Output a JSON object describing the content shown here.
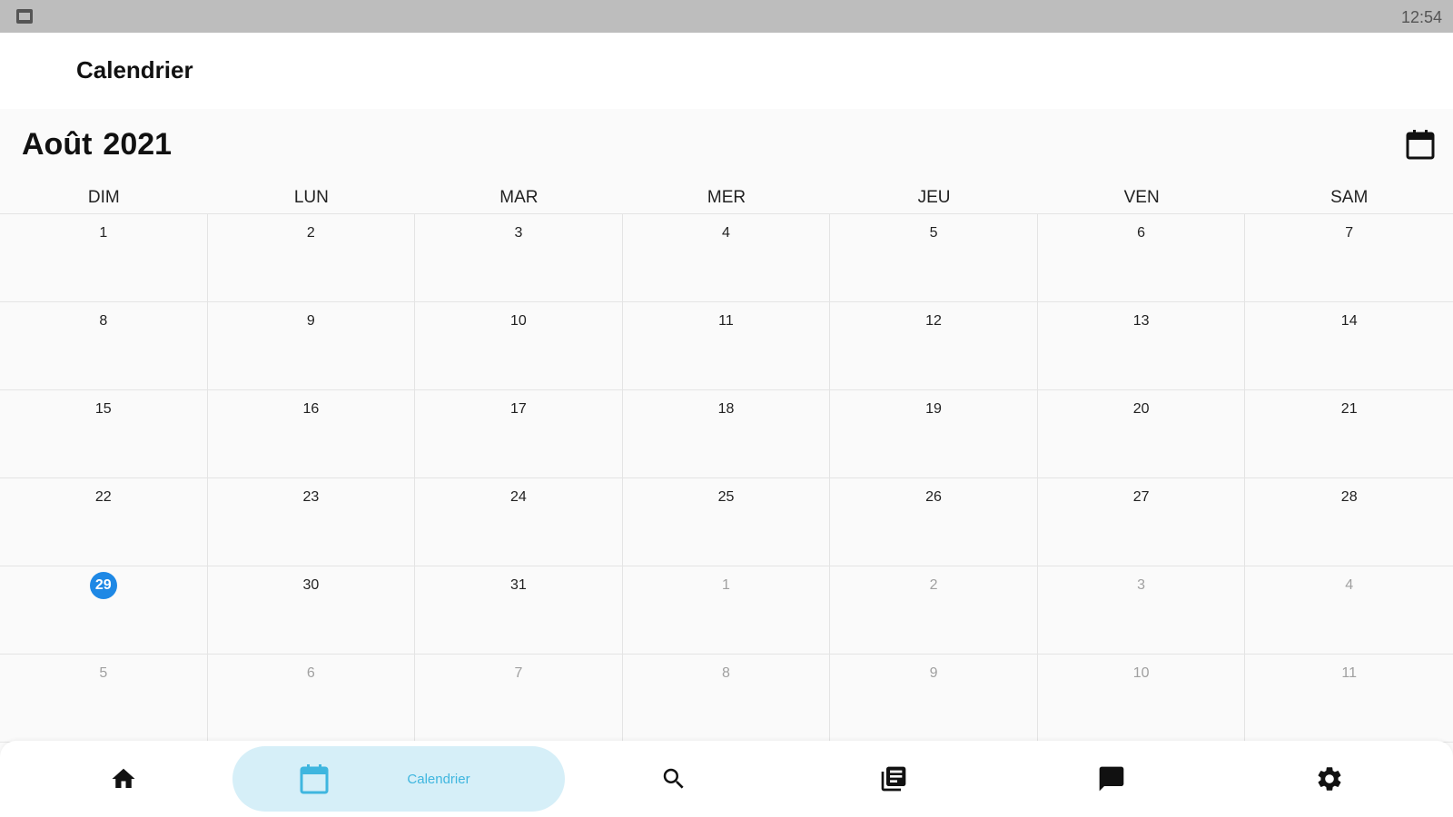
{
  "status_bar": {
    "time": "12:54"
  },
  "app_bar": {
    "title": "Calendrier"
  },
  "calendar": {
    "month": "Août",
    "year": "2021",
    "weekdays": [
      "DIM",
      "LUN",
      "MAR",
      "MER",
      "JEU",
      "VEN",
      "SAM"
    ],
    "days": [
      {
        "n": "1",
        "muted": false
      },
      {
        "n": "2",
        "muted": false
      },
      {
        "n": "3",
        "muted": false
      },
      {
        "n": "4",
        "muted": false
      },
      {
        "n": "5",
        "muted": false
      },
      {
        "n": "6",
        "muted": false
      },
      {
        "n": "7",
        "muted": false
      },
      {
        "n": "8",
        "muted": false
      },
      {
        "n": "9",
        "muted": false
      },
      {
        "n": "10",
        "muted": false
      },
      {
        "n": "11",
        "muted": false
      },
      {
        "n": "12",
        "muted": false
      },
      {
        "n": "13",
        "muted": false
      },
      {
        "n": "14",
        "muted": false
      },
      {
        "n": "15",
        "muted": false
      },
      {
        "n": "16",
        "muted": false
      },
      {
        "n": "17",
        "muted": false
      },
      {
        "n": "18",
        "muted": false
      },
      {
        "n": "19",
        "muted": false
      },
      {
        "n": "20",
        "muted": false
      },
      {
        "n": "21",
        "muted": false
      },
      {
        "n": "22",
        "muted": false
      },
      {
        "n": "23",
        "muted": false
      },
      {
        "n": "24",
        "muted": false
      },
      {
        "n": "25",
        "muted": false
      },
      {
        "n": "26",
        "muted": false
      },
      {
        "n": "27",
        "muted": false
      },
      {
        "n": "28",
        "muted": false
      },
      {
        "n": "29",
        "muted": false,
        "today": true
      },
      {
        "n": "30",
        "muted": false
      },
      {
        "n": "31",
        "muted": false
      },
      {
        "n": "1",
        "muted": true
      },
      {
        "n": "2",
        "muted": true
      },
      {
        "n": "3",
        "muted": true
      },
      {
        "n": "4",
        "muted": true
      },
      {
        "n": "5",
        "muted": true
      },
      {
        "n": "6",
        "muted": true
      },
      {
        "n": "7",
        "muted": true
      },
      {
        "n": "8",
        "muted": true
      },
      {
        "n": "9",
        "muted": true
      },
      {
        "n": "10",
        "muted": true
      },
      {
        "n": "11",
        "muted": true
      }
    ]
  },
  "bottom_nav": {
    "items": [
      {
        "icon": "home-icon",
        "label": ""
      },
      {
        "icon": "calendar-icon",
        "label": "Calendrier",
        "active": true
      },
      {
        "icon": "search-icon",
        "label": ""
      },
      {
        "icon": "library-icon",
        "label": ""
      },
      {
        "icon": "chat-icon",
        "label": ""
      },
      {
        "icon": "settings-icon",
        "label": ""
      }
    ]
  },
  "colors": {
    "accent": "#1e88e5",
    "nav_active_bg": "#d6eff8",
    "nav_active_text": "#3fb6df",
    "status_bar": "#bdbdbd",
    "calendar_bg": "#fafafa"
  }
}
